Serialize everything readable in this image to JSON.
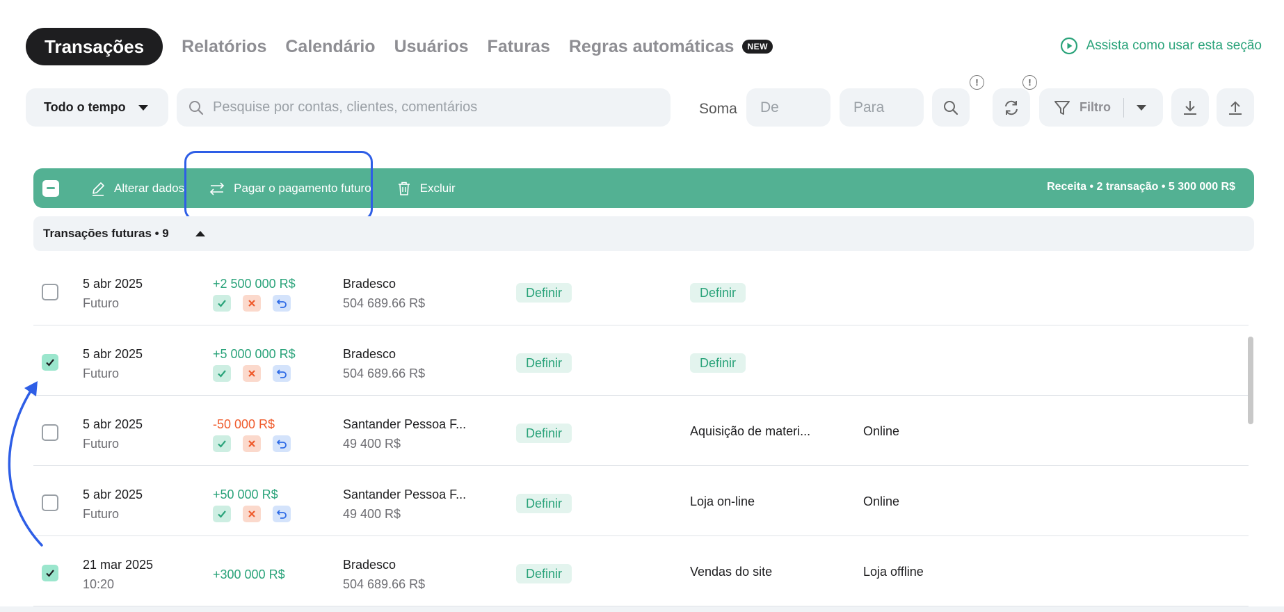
{
  "tabs": {
    "active": "Transações",
    "items": [
      "Relatórios",
      "Calendário",
      "Usuários",
      "Faturas",
      "Regras automáticas"
    ],
    "badge": "NEW"
  },
  "help_link": "Assista como usar esta seção",
  "toolbar": {
    "period": "Todo o tempo",
    "search_placeholder": "Pesquise por contas, clientes, comentários",
    "soma_label": "Soma",
    "from_placeholder": "De",
    "to_placeholder": "Para",
    "alert_glyph": "!",
    "filter_label": "Filtro"
  },
  "action_bar": {
    "edit": "Alterar dados",
    "pay_future": "Pagar o pagamento futuro",
    "delete": "Excluir",
    "summary": "Receita • 2 transação • 5 300 000 R$",
    "color": "#53b193"
  },
  "group": {
    "title": "Transações futuras • 9"
  },
  "rows": [
    {
      "date": "5 abr 2025",
      "sub": "Futuro",
      "amount": "+2 500 000 R$",
      "account": "Bradesco",
      "balance": "504 689.66 R$",
      "pill1": "Definir",
      "pill2": "Definir",
      "category": "",
      "channel": "",
      "checked": false
    },
    {
      "date": "5 abr 2025",
      "sub": "Futuro",
      "amount": "+5 000 000 R$",
      "account": "Bradesco",
      "balance": "504 689.66 R$",
      "pill1": "Definir",
      "pill2": "Definir",
      "category": "",
      "channel": "",
      "checked": true
    },
    {
      "date": "5 abr 2025",
      "sub": "Futuro",
      "amount": "-50 000 R$",
      "account": "Santander Pessoa F...",
      "balance": "49 400 R$",
      "pill1": "Definir",
      "pill2": "",
      "category": "Aquisição de materi...",
      "channel": "Online",
      "checked": false
    },
    {
      "date": "5 abr 2025",
      "sub": "Futuro",
      "amount": "+50 000 R$",
      "account": "Santander Pessoa F...",
      "balance": "49 400 R$",
      "pill1": "Definir",
      "pill2": "",
      "category": "Loja on-line",
      "channel": "Online",
      "checked": false
    },
    {
      "date": "21 mar 2025",
      "sub": "10:20",
      "amount": "+300 000 R$",
      "account": "Bradesco",
      "balance": "504 689.66 R$",
      "pill1": "Definir",
      "pill2": "",
      "category": "Vendas do site",
      "channel": "Loja offline",
      "checked": true
    }
  ],
  "colors": {
    "accent": "#2aa37a",
    "negative": "#ef5a2b",
    "highlight": "#2e5ee6"
  }
}
